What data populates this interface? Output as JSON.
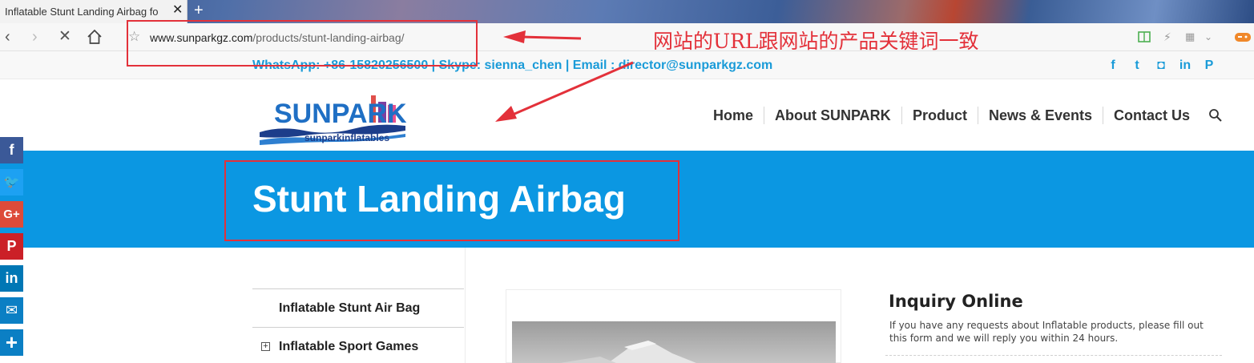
{
  "browser": {
    "tab_title": "Inflatable Stunt Landing Airbag fo",
    "tab_close": "✕",
    "new_tab": "+",
    "url_host": "www.sunparkgz.com",
    "url_path": "/products/stunt-landing-airbag/"
  },
  "annotation": {
    "text": "网站的URL跟网站的产品关键词一致",
    "color": "#e3313a"
  },
  "topbar": {
    "contact": "WhatsApp: +86-15820256500 | Skype: sienna_chen | Email : director@sunparkgz.com",
    "social_icons": [
      "facebook-icon",
      "twitter-icon",
      "instagram-icon",
      "linkedin-icon",
      "pinterest-icon"
    ],
    "social_glyphs": [
      "f",
      "t",
      "◘",
      "in",
      "P"
    ]
  },
  "logo": {
    "brand_text": "SUNPARK",
    "subtitle": "sunparkinflatables"
  },
  "menu": {
    "items": [
      "Home",
      "About SUNPARK",
      "Product",
      "News & Events",
      "Contact Us"
    ]
  },
  "banner": {
    "title": "Stunt Landing Airbag"
  },
  "sidebar": {
    "items": [
      "Inflatable Stunt Air Bag",
      "Inflatable Sport Games"
    ],
    "expand_glyph": "+"
  },
  "inquiry": {
    "title": "Inquiry Online",
    "description": "If you have any requests about Inflatable products, please fill out this form and we will reply you within 24 hours."
  },
  "share_bar": {
    "buttons": [
      {
        "icon": "facebook-icon",
        "glyph": "f",
        "color": "#3b5998"
      },
      {
        "icon": "twitter-icon",
        "glyph": "🐦",
        "color": "#1da1f2"
      },
      {
        "icon": "google-plus-icon",
        "glyph": "G+",
        "color": "#dd4b39"
      },
      {
        "icon": "pinterest-icon",
        "glyph": "P",
        "color": "#cb2027"
      },
      {
        "icon": "linkedin-icon",
        "glyph": "in",
        "color": "#0077b5"
      },
      {
        "icon": "email-icon",
        "glyph": "✉",
        "color": "#0b7fc4"
      },
      {
        "icon": "share-plus-icon",
        "glyph": "+",
        "color": "#0b7fc4"
      }
    ]
  },
  "colors": {
    "brand_blue": "#0b97e2",
    "link_blue": "#1a9bd8"
  }
}
